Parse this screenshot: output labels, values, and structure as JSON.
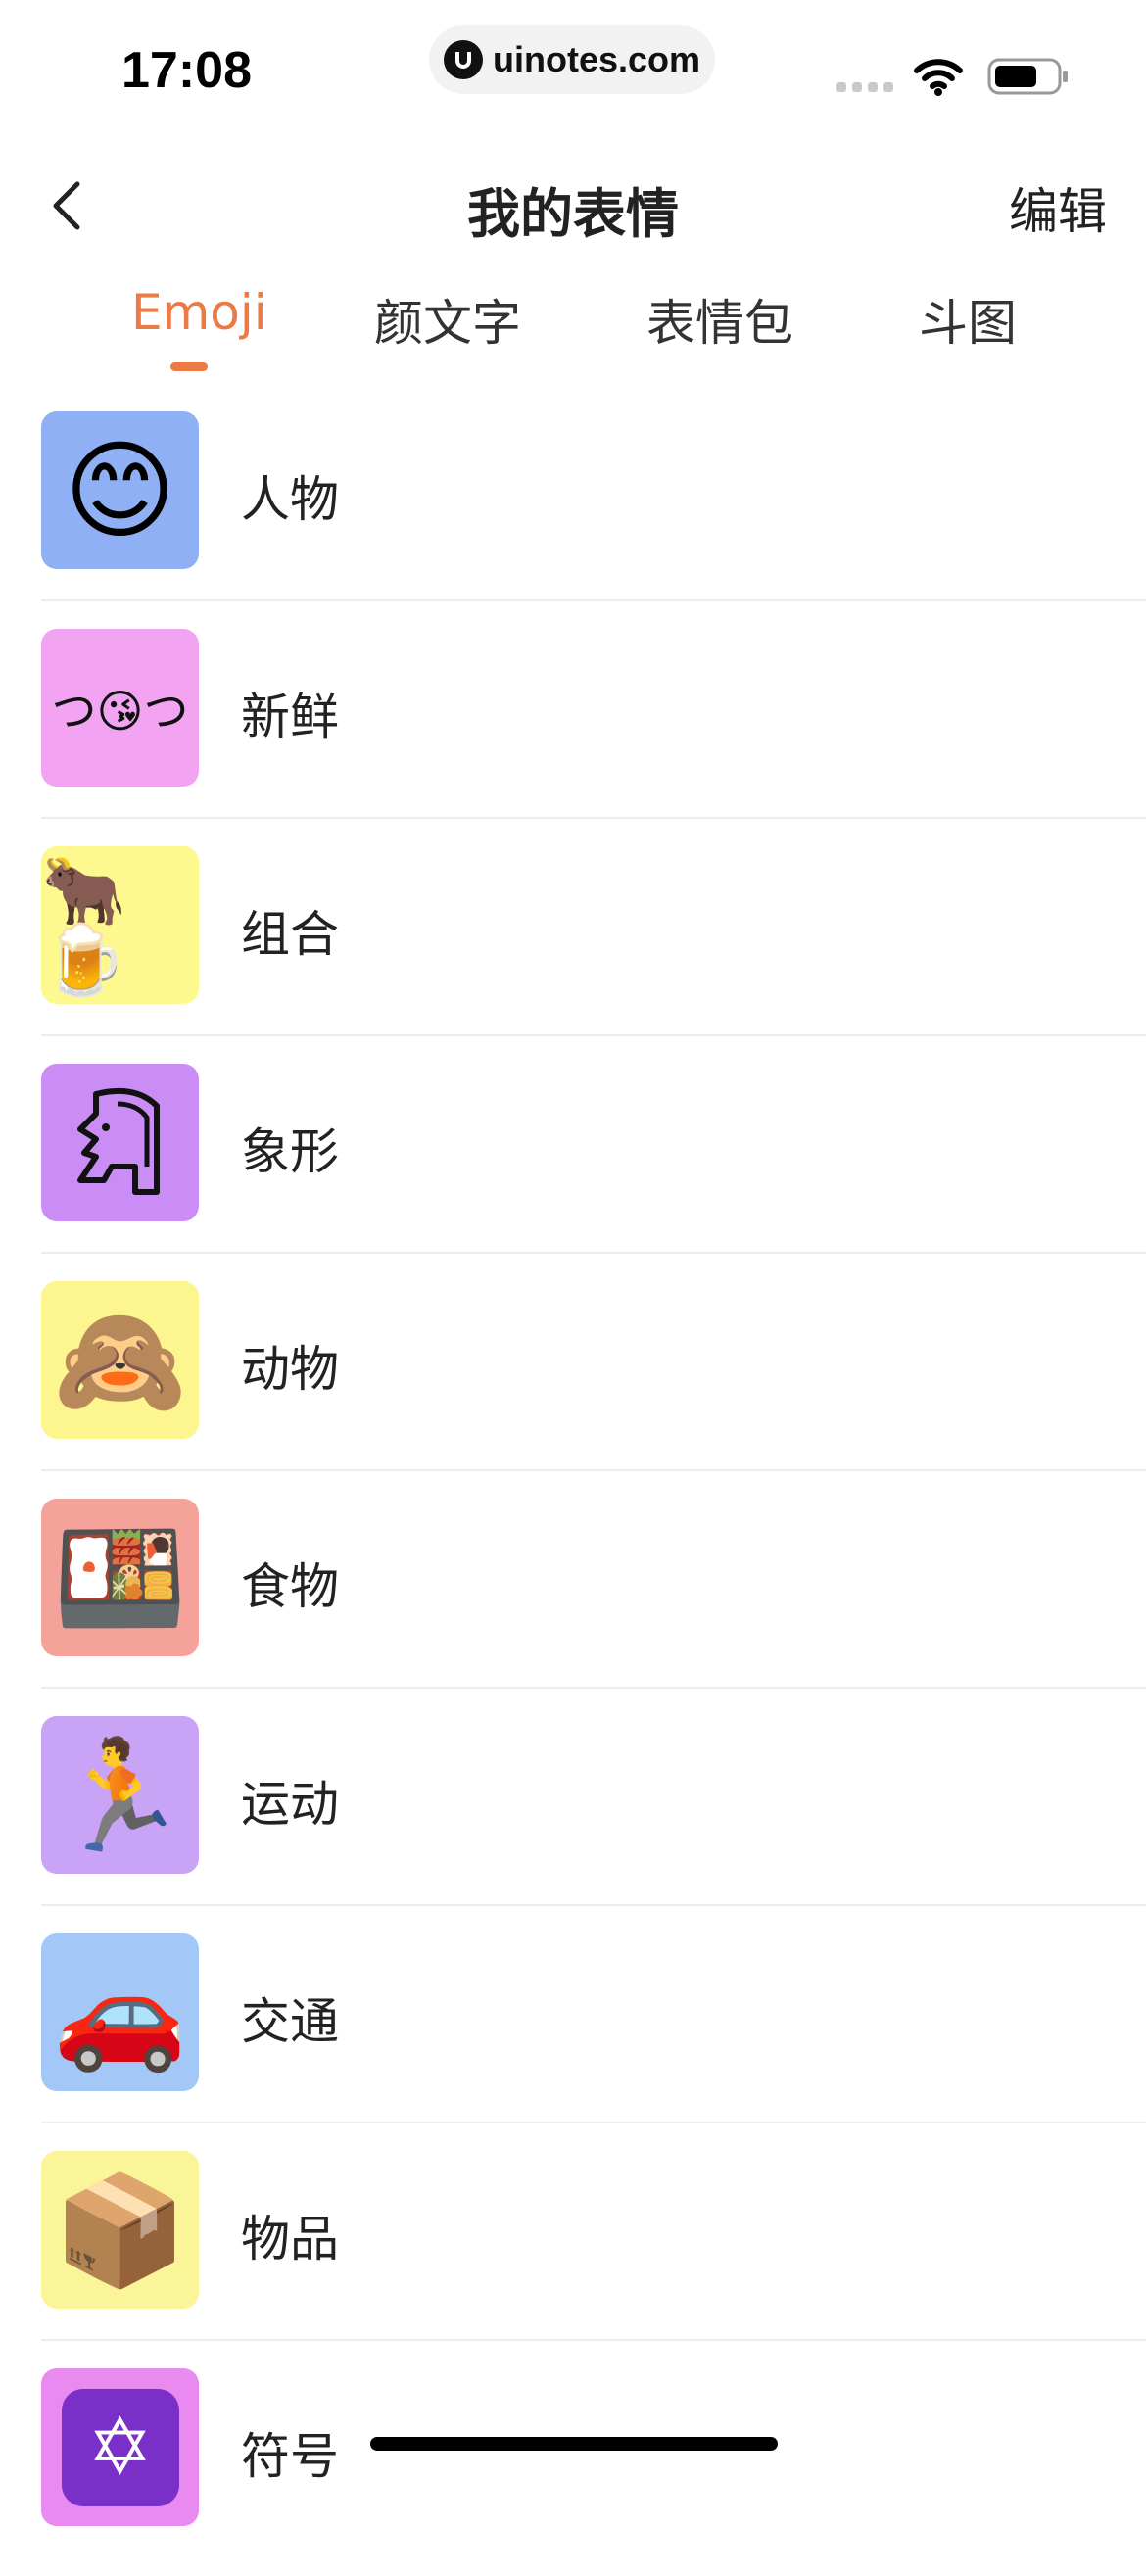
{
  "status_bar": {
    "time": "17:08",
    "url": "uinotes.com"
  },
  "header": {
    "back_icon": "chevron-left-icon",
    "title": "我的表情",
    "edit_label": "编辑"
  },
  "tabs": [
    {
      "label": "Emoji",
      "active": true
    },
    {
      "label": "颜文字",
      "active": false
    },
    {
      "label": "表情包",
      "active": false
    },
    {
      "label": "斗图",
      "active": false
    }
  ],
  "colors": {
    "accent": "#ec7a44"
  },
  "categories": [
    {
      "label": "人物",
      "icon": "smiling-face-icon",
      "bg": "#8fb0f5",
      "glyph": "😊"
    },
    {
      "label": "新鲜",
      "icon": "kaomoji-kiss-icon",
      "bg": "#f2a3f2",
      "glyph": "つ😘つ"
    },
    {
      "label": "组合",
      "icon": "ox-beer-icon",
      "bg": "#fdf98e",
      "glyph": "🐂🍺"
    },
    {
      "label": "象形",
      "icon": "hieroglyph-head-icon",
      "bg": "#c98df5",
      "glyph": "𓁷"
    },
    {
      "label": "动物",
      "icon": "see-no-evil-monkey-icon",
      "bg": "#fdf58e",
      "glyph": "🙈"
    },
    {
      "label": "食物",
      "icon": "bento-box-icon",
      "bg": "#f5a39a",
      "glyph": "🍱"
    },
    {
      "label": "运动",
      "icon": "runner-icon",
      "bg": "#c9a3f5",
      "glyph": "🏃"
    },
    {
      "label": "交通",
      "icon": "car-icon",
      "bg": "#a3c8f7",
      "glyph": "🚗"
    },
    {
      "label": "物品",
      "icon": "package-icon",
      "bg": "#fbf59a",
      "glyph": "📦"
    },
    {
      "label": "符号",
      "icon": "star-of-david-icon",
      "bg": "#e98af0",
      "glyph": "✡"
    }
  ]
}
